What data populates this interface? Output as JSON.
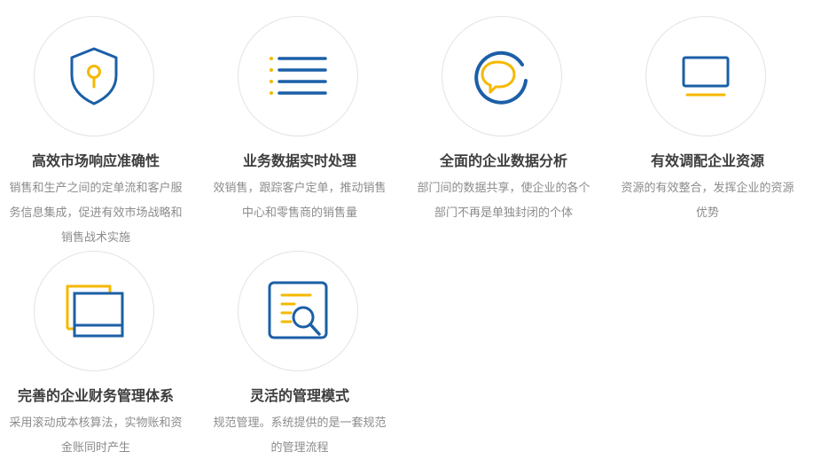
{
  "colors": {
    "blue": "#1b5fa7",
    "yellow": "#f5b800",
    "title": "#3d3d3d",
    "desc": "#8c8c8c",
    "circle_border": "#e3e3e3"
  },
  "features": [
    {
      "icon": "shield-keyhole-icon",
      "title": "高效市场响应准确性",
      "desc_lines": [
        "销售和生产之间的定单流和客户服",
        "务信息集成，促进有效市场战略和",
        "销售战术实施"
      ]
    },
    {
      "icon": "list-lines-icon",
      "title": "业务数据实时处理",
      "desc_lines": [
        "效销售，跟踪客户定单，推动销售",
        "中心和零售商的销售量"
      ]
    },
    {
      "icon": "chat-bubble-cycle-icon",
      "title": "全面的企业数据分析",
      "desc_lines": [
        "部门间的数据共享，使企业的各个",
        "部门不再是单独封闭的个体"
      ]
    },
    {
      "icon": "monitor-icon",
      "title": "有效调配企业资源",
      "desc_lines": [
        "资源的有效整合，发挥企业的资源",
        "优势"
      ]
    },
    {
      "icon": "stacked-windows-icon",
      "title": "完善的企业财务管理体系",
      "desc_lines": [
        "采用滚动成本核算法，实物账和资",
        "金账同时产生"
      ]
    },
    {
      "icon": "document-search-icon",
      "title": "灵活的管理模式",
      "desc_lines": [
        "规范管理。系统提供的是一套规范",
        "的管理流程"
      ]
    }
  ]
}
